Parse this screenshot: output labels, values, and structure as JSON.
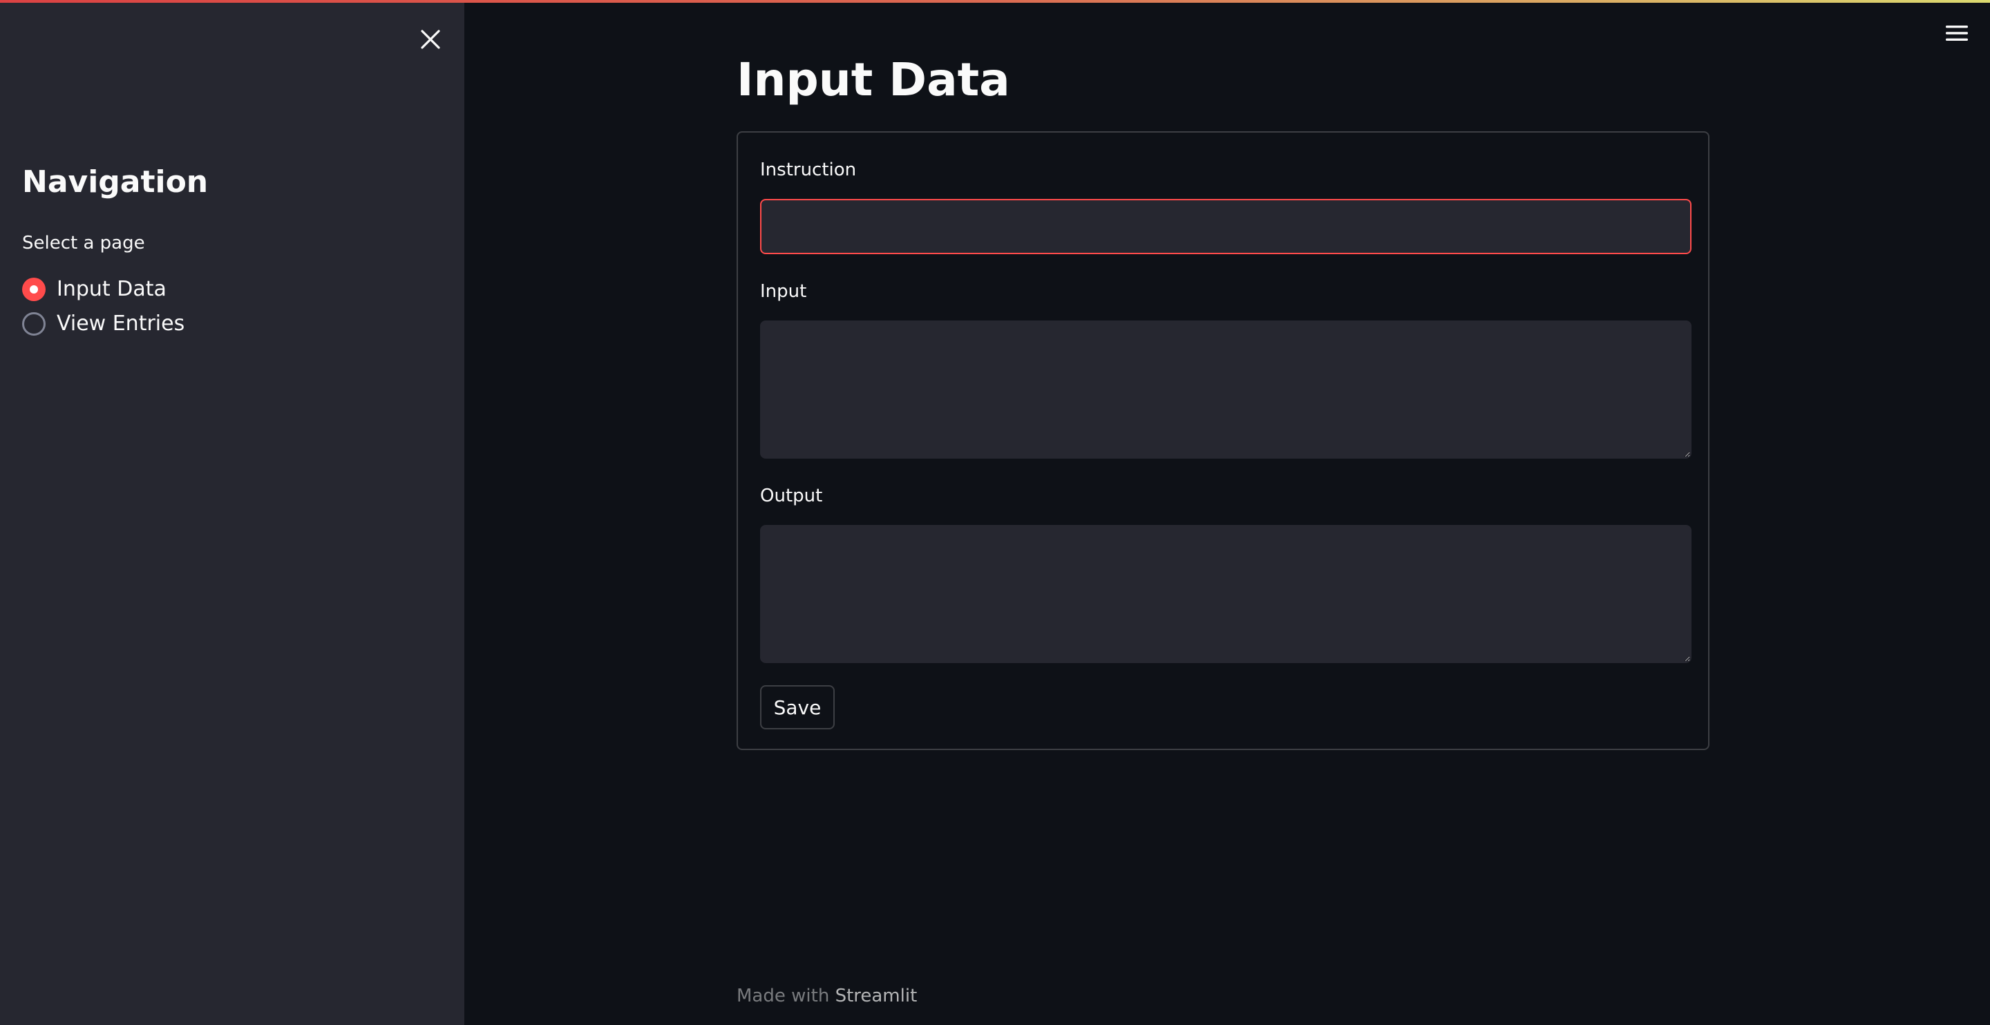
{
  "colors": {
    "primary": "#ff4b4b",
    "background": "#0e1117",
    "sidebar_background": "#262730",
    "text": "#fafafa"
  },
  "sidebar": {
    "close_icon": "close-icon",
    "title": "Navigation",
    "radio_label": "Select a page",
    "options": [
      {
        "label": "Input Data",
        "selected": true
      },
      {
        "label": "View Entries",
        "selected": false
      }
    ]
  },
  "header": {
    "menu_icon": "hamburger-menu-icon"
  },
  "main": {
    "title": "Input Data",
    "form": {
      "instruction": {
        "label": "Instruction",
        "value": ""
      },
      "input": {
        "label": "Input",
        "value": ""
      },
      "output": {
        "label": "Output",
        "value": ""
      },
      "save_label": "Save"
    }
  },
  "footer": {
    "prefix": "Made with",
    "brand": "Streamlit"
  }
}
